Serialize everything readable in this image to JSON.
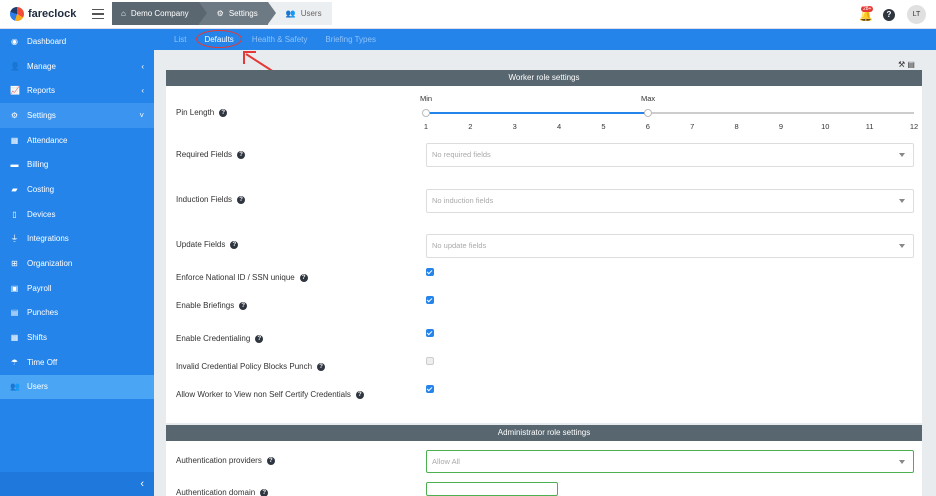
{
  "brand": {
    "name": "fareclock"
  },
  "breadcrumbs": [
    {
      "label": "Demo Company",
      "icon": "home-icon"
    },
    {
      "label": "Settings",
      "icon": "gear-icon"
    },
    {
      "label": "Users",
      "icon": "users-icon"
    }
  ],
  "header": {
    "notifications": "28+",
    "avatar": "LT"
  },
  "sidebar": {
    "items": [
      {
        "label": "Dashboard",
        "icon": "dashboard-icon"
      },
      {
        "label": "Manage",
        "icon": "user-icon",
        "expand": "‹"
      },
      {
        "label": "Reports",
        "icon": "chart-icon",
        "expand": "‹"
      },
      {
        "label": "Settings",
        "icon": "gear-icon",
        "expand": "˅"
      },
      {
        "label": "Attendance",
        "icon": "attendance-icon"
      },
      {
        "label": "Billing",
        "icon": "billing-icon"
      },
      {
        "label": "Costing",
        "icon": "folder-icon"
      },
      {
        "label": "Devices",
        "icon": "device-icon"
      },
      {
        "label": "Integrations",
        "icon": "plug-icon"
      },
      {
        "label": "Organization",
        "icon": "org-icon"
      },
      {
        "label": "Payroll",
        "icon": "payroll-icon"
      },
      {
        "label": "Punches",
        "icon": "punch-icon"
      },
      {
        "label": "Shifts",
        "icon": "calendar-icon"
      },
      {
        "label": "Time Off",
        "icon": "umbrella-icon"
      },
      {
        "label": "Users",
        "icon": "users-icon"
      }
    ],
    "collapse": "‹"
  },
  "tabs": [
    "List",
    "Defaults",
    "Health & Safety",
    "Briefing Types"
  ],
  "worker": {
    "title": "Worker role settings",
    "pin_length": {
      "label": "Pin Length",
      "min_label": "Min",
      "max_label": "Max",
      "min": 1,
      "max": 6,
      "ticks": [
        "1",
        "2",
        "3",
        "4",
        "5",
        "6",
        "7",
        "8",
        "9",
        "10",
        "11",
        "12"
      ]
    },
    "required": {
      "label": "Required Fields",
      "placeholder": "No required fields"
    },
    "induction": {
      "label": "Induction Fields",
      "placeholder": "No induction fields"
    },
    "update": {
      "label": "Update Fields",
      "placeholder": "No update fields"
    },
    "checks": [
      {
        "label": "Enforce National ID / SSN unique",
        "checked": true
      },
      {
        "label": "Enable Briefings",
        "checked": true
      },
      {
        "label": "Enable Credentialing",
        "checked": true
      },
      {
        "label": "Invalid Credential Policy Blocks Punch",
        "checked": false
      },
      {
        "label": "Allow Worker to View non Self Certify Credentials",
        "checked": true
      }
    ]
  },
  "admin": {
    "title": "Administrator role settings",
    "auth_providers": {
      "label": "Authentication providers",
      "value": "Allow All"
    },
    "auth_domain": {
      "label": "Authentication domain"
    }
  },
  "colors": {
    "accent": "#2584ea",
    "header": "#57666f",
    "annotation": "#e53935"
  }
}
